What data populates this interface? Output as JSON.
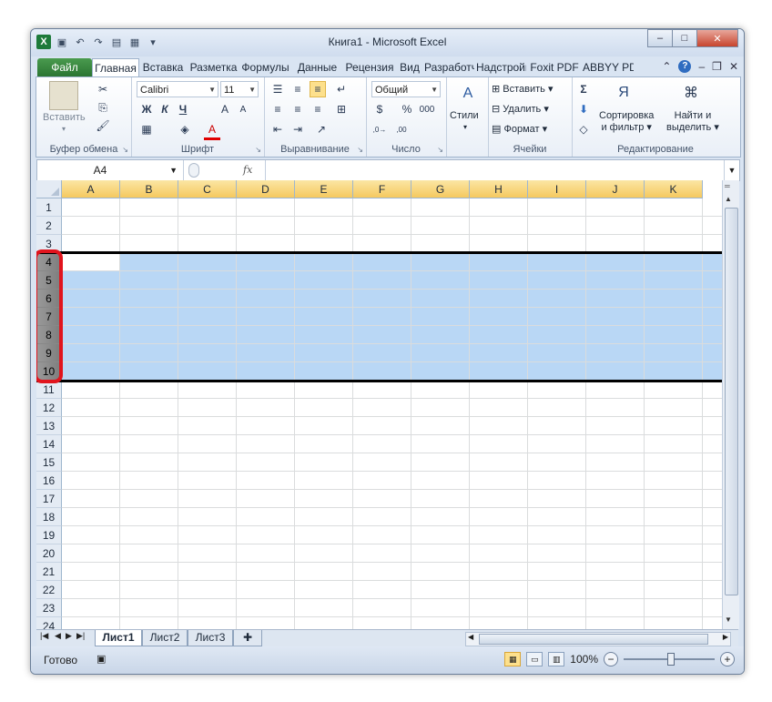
{
  "window": {
    "title": "Книга1  -  Microsoft Excel",
    "controls": {
      "minimize": "–",
      "maximize": "□",
      "close": "✕"
    }
  },
  "qat": {
    "app_icon": "X",
    "save": "💾",
    "undo": "↶",
    "redo": "↷"
  },
  "tabs": [
    {
      "label": "Файл"
    },
    {
      "label": "Главная"
    },
    {
      "label": "Вставка"
    },
    {
      "label": "Разметка"
    },
    {
      "label": "Формулы"
    },
    {
      "label": "Данные"
    },
    {
      "label": "Рецензия"
    },
    {
      "label": "Вид"
    },
    {
      "label": "Разработчик"
    },
    {
      "label": "Надстройки"
    },
    {
      "label": "Foxit PDF"
    },
    {
      "label": "ABBYY PDF"
    }
  ],
  "ribbon": {
    "clipboard": {
      "label": "Буфер обмена",
      "paste": "Вставить"
    },
    "font": {
      "label": "Шрифт",
      "name": "Calibri",
      "size": "11",
      "bold": "Ж",
      "italic": "К",
      "underline": "Ч",
      "grow": "A",
      "shrink": "A",
      "color": "A"
    },
    "alignment": {
      "label": "Выравнивание"
    },
    "number": {
      "label": "Число",
      "format": "Общий",
      "percent": "%",
      "thousands": "000",
      "inc": ",0\n,00",
      "dec": ",00\n,0"
    },
    "styles": {
      "label": "Стили"
    },
    "cells": {
      "label": "Ячейки",
      "insert": "Вставить",
      "delete": "Удалить",
      "format": "Формат"
    },
    "editing": {
      "label": "Редактирование",
      "sum": "Σ",
      "sort1": "Сортировка",
      "sort2": "и фильтр",
      "find1": "Найти и",
      "find2": "выделить"
    }
  },
  "formula_bar": {
    "name_box": "A4",
    "fx": "fx",
    "value": ""
  },
  "columns": [
    "A",
    "B",
    "C",
    "D",
    "E",
    "F",
    "G",
    "H",
    "I",
    "J",
    "K"
  ],
  "rows": [
    "1",
    "2",
    "3",
    "4",
    "5",
    "6",
    "7",
    "8",
    "9",
    "10",
    "11",
    "12",
    "13",
    "14",
    "15",
    "16",
    "17",
    "18",
    "19",
    "20",
    "21",
    "22",
    "23",
    "24"
  ],
  "selection": {
    "name": "A4",
    "rows": [
      "4",
      "10"
    ]
  },
  "sheets": [
    {
      "label": "Лист1"
    },
    {
      "label": "Лист2"
    },
    {
      "label": "Лист3"
    }
  ],
  "status": {
    "ready": "Готово",
    "zoom": "100%"
  }
}
